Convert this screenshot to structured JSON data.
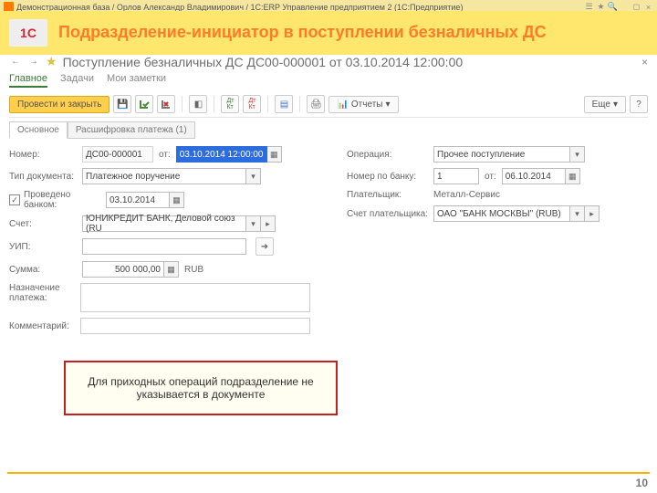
{
  "titlebar": "Демонстрационная база / Орлов Александр Владимирович / 1C:ERP Управление предприятием 2  (1С:Предприятие)",
  "slide_title": "Подразделение-инициатор в поступлении безналичных ДС",
  "logo_text": "1C",
  "doc_title": "Поступление безналичных ДС ДС00-000001 от 03.10.2014 12:00:00",
  "tabs1": {
    "main": "Главное",
    "tasks": "Задачи",
    "notes": "Мои заметки"
  },
  "toolbar": {
    "submit": "Провести и закрыть",
    "reports": "Отчеты",
    "more": "Еще"
  },
  "tabs2": {
    "main": "Основное",
    "detail": "Расшифровка платежа (1)"
  },
  "left": {
    "number_lbl": "Номер:",
    "number_val": "ДС00-000001",
    "from_lbl": "от:",
    "date_val": "03.10.2014 12:00:00",
    "doctype_lbl": "Тип документа:",
    "doctype_val": "Платежное поручение",
    "bank_chk": "Проведено банком:",
    "bank_date": "03.10.2014",
    "account_lbl": "Счет:",
    "account_val": "ЮНИКРЕДИТ БАНК, Деловой союз (RU",
    "uip_lbl": "УИП:",
    "uip_val": "",
    "sum_lbl": "Сумма:",
    "sum_val": "500 000,00",
    "sum_cur": "RUB",
    "purpose_lbl": "Назначение платежа:",
    "comment_lbl": "Комментарий:"
  },
  "right": {
    "op_lbl": "Операция:",
    "op_val": "Прочее поступление",
    "banknum_lbl": "Номер по банку:",
    "banknum_val": "1",
    "from_lbl": "от:",
    "banknum_date": "06.10.2014",
    "payer_lbl": "Плательщик:",
    "payer_val": "Металл-Сервис",
    "payer_acc_lbl": "Счет плательщика:",
    "payer_acc_val": "ОАО \"БАНК МОСКВЫ\" (RUB)"
  },
  "callout": "Для приходных операций подразделение не указывается в документе",
  "page_number": "10"
}
